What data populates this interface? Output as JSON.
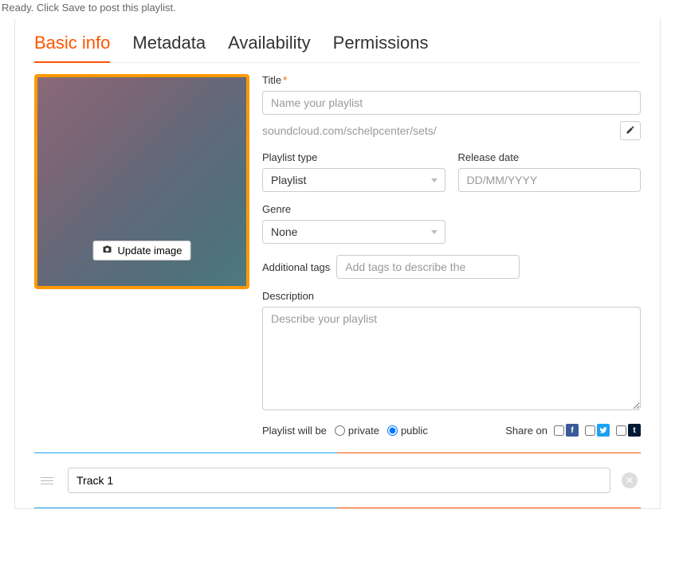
{
  "status_text": "Ready. Click Save to post this playlist.",
  "tabs": {
    "basic_info": "Basic info",
    "metadata": "Metadata",
    "availability": "Availability",
    "permissions": "Permissions"
  },
  "image": {
    "update_label": "Update image"
  },
  "fields": {
    "title_label": "Title",
    "title_required": "*",
    "title_placeholder": "Name your playlist",
    "url_text": "soundcloud.com/schelpcenter/sets/",
    "playlist_type_label": "Playlist type",
    "playlist_type_value": "Playlist",
    "release_date_label": "Release date",
    "release_date_placeholder": "DD/MM/YYYY",
    "genre_label": "Genre",
    "genre_value": "None",
    "tags_label": "Additional tags",
    "tags_placeholder": "Add tags to describe the",
    "description_label": "Description",
    "description_placeholder": "Describe your playlist"
  },
  "privacy": {
    "label": "Playlist will be",
    "private": "private",
    "public": "public",
    "selected": "public"
  },
  "share": {
    "label": "Share on"
  },
  "tracks": {
    "items": [
      {
        "title": "Track 1"
      }
    ]
  }
}
